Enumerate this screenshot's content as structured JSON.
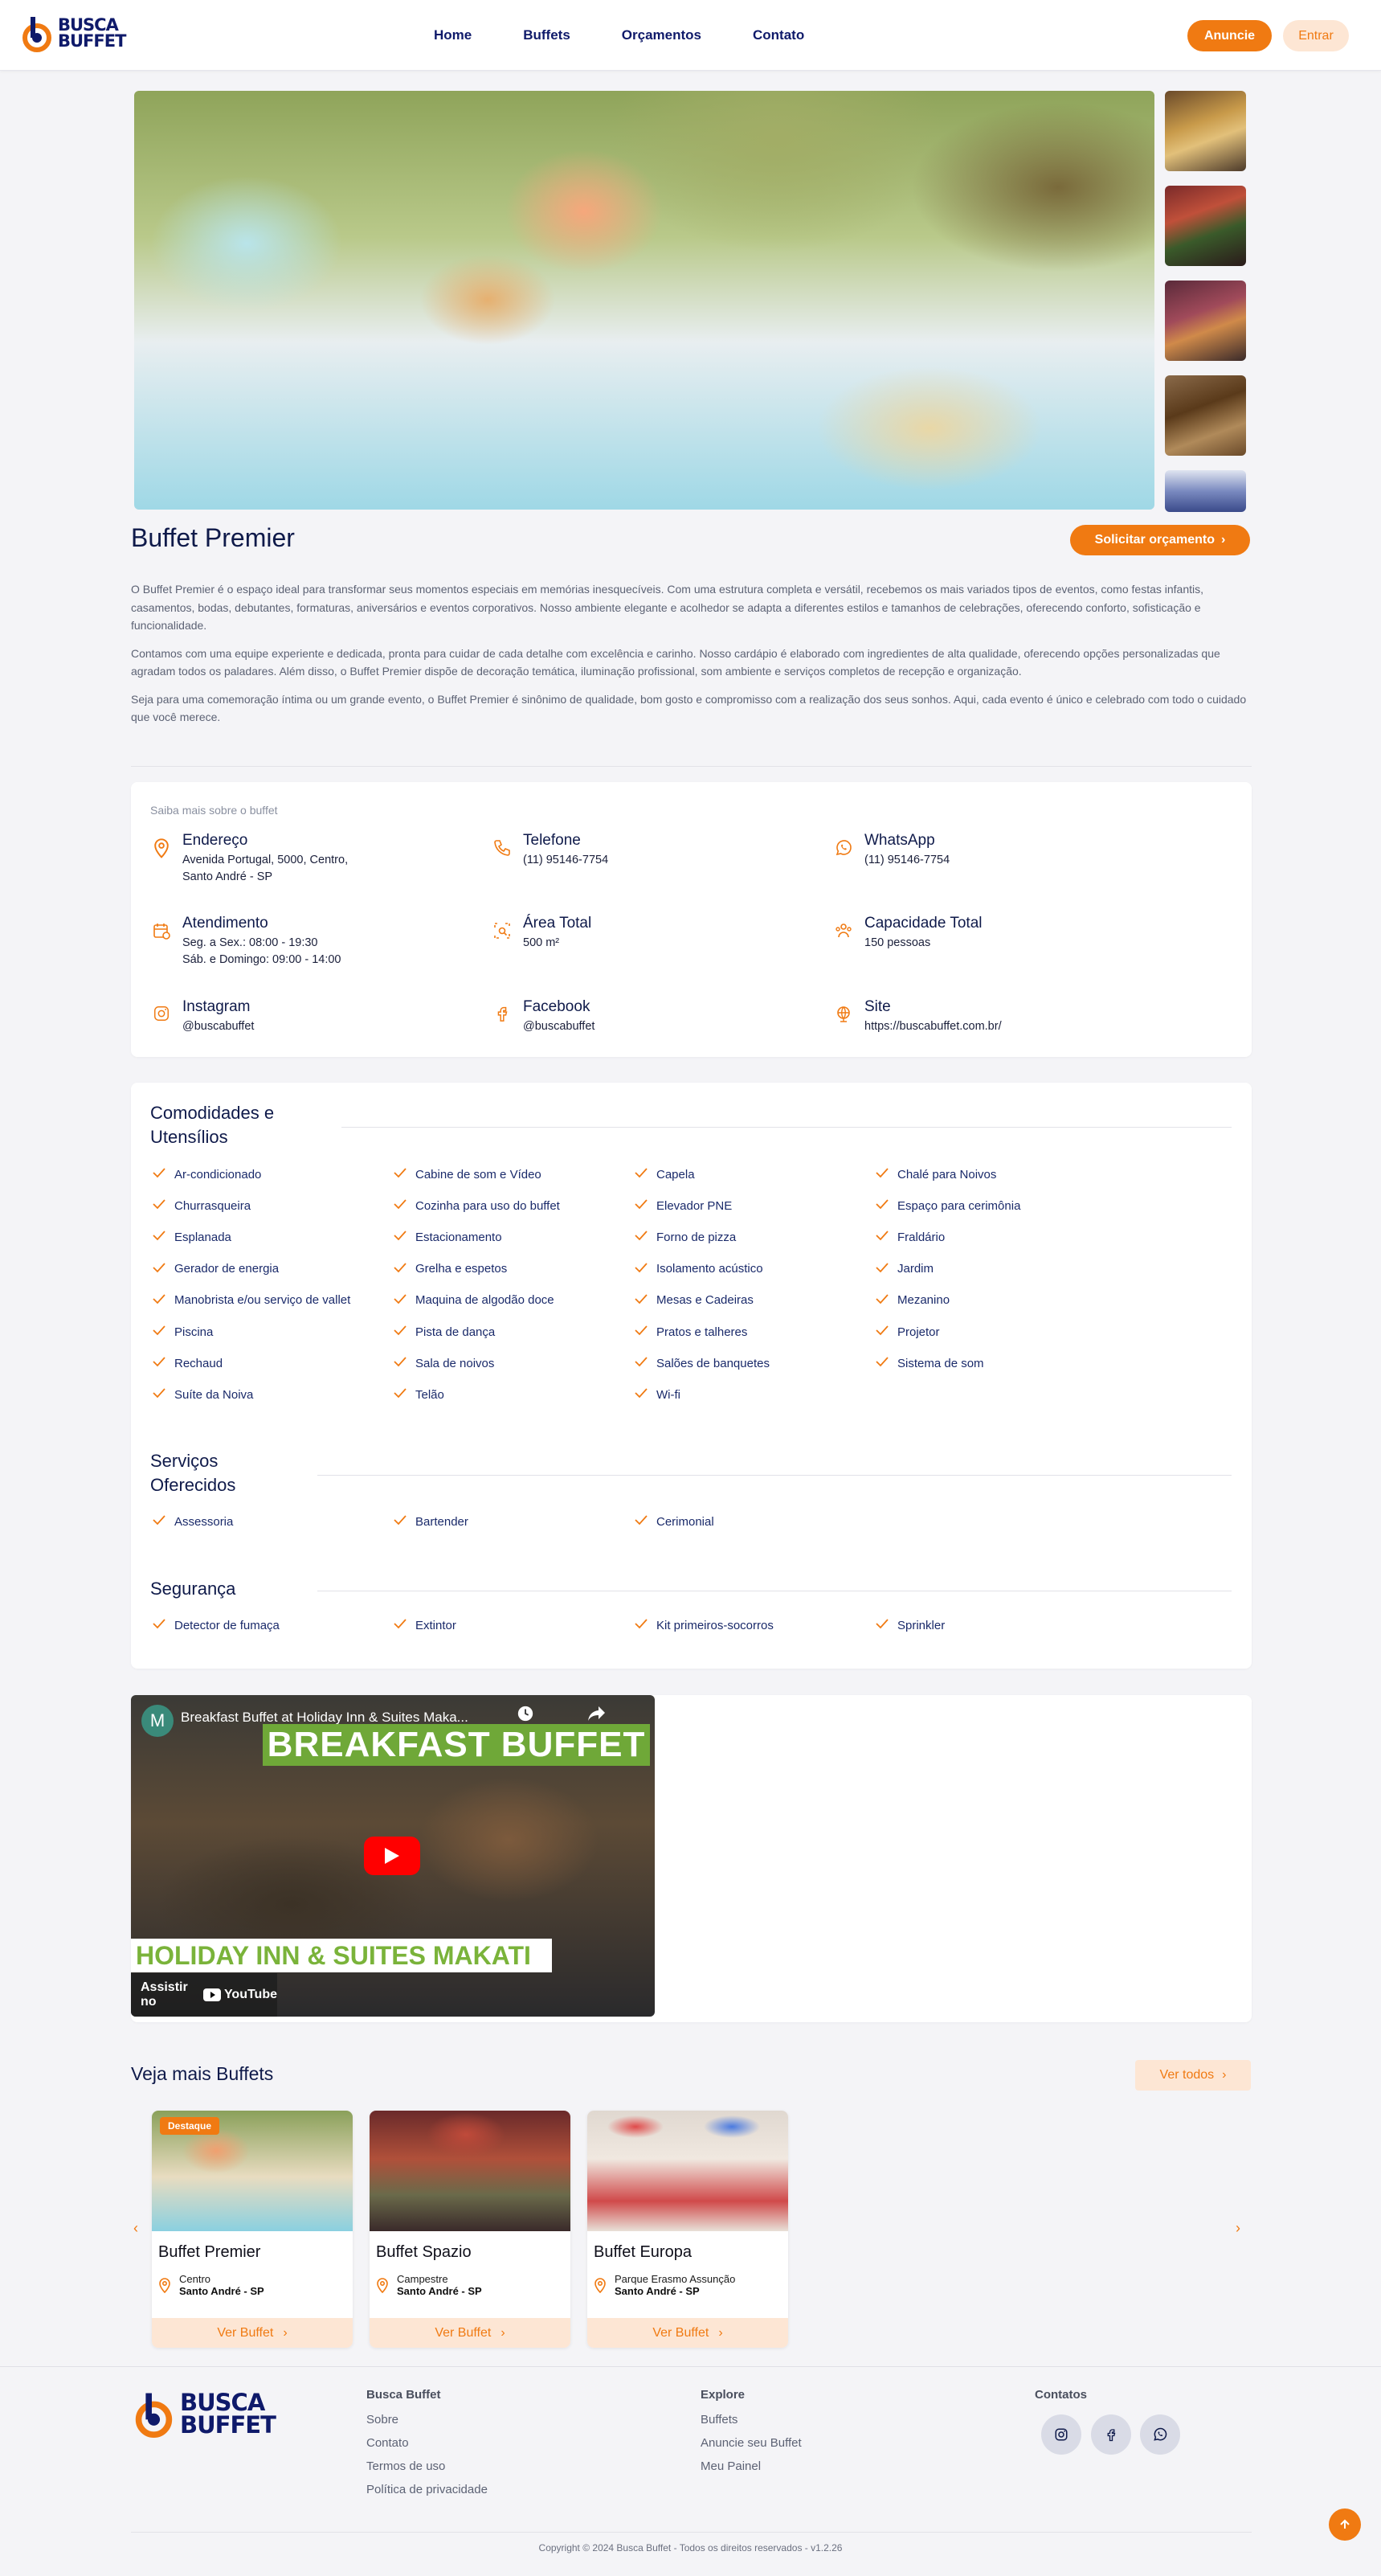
{
  "brand": {
    "line1": "BUSCA",
    "line2": "BUFFET"
  },
  "nav": {
    "links": [
      "Home",
      "Buffets",
      "Orçamentos",
      "Contato"
    ],
    "anuncie": "Anuncie",
    "entrar": "Entrar"
  },
  "buffet": {
    "title": "Buffet Premier",
    "cta": "Solicitar orçamento",
    "description": [
      "O Buffet Premier é o espaço ideal para transformar seus momentos especiais em memórias inesquecíveis. Com uma estrutura completa e versátil, recebemos os mais variados tipos de eventos, como festas infantis, casamentos, bodas, debutantes, formaturas, aniversários e eventos corporativos. Nosso ambiente elegante e acolhedor se adapta a diferentes estilos e tamanhos de celebrações, oferecendo conforto, sofisticação e funcionalidade.",
      "Contamos com uma equipe experiente e dedicada, pronta para cuidar de cada detalhe com excelência e carinho. Nosso cardápio é elaborado com ingredientes de alta qualidade, oferecendo opções personalizadas que agradam todos os paladares. Além disso, o Buffet Premier dispõe de decoração temática, iluminação profissional, som ambiente e serviços completos de recepção e organização.",
      "Seja para uma comemoração íntima ou um grande evento, o Buffet Premier é sinônimo de qualidade, bom gosto e compromisso com a realização dos seus sonhos. Aqui, cada evento é único e celebrado com todo o cuidado que você merece."
    ]
  },
  "info": {
    "heading": "Saiba mais sobre o buffet",
    "items": [
      {
        "label": "Endereço",
        "value": "Avenida Portugal, 5000, Centro,",
        "value2": "Santo André - SP",
        "icon": "map-pin-icon"
      },
      {
        "label": "Telefone",
        "value": "(11) 95146-7754",
        "icon": "phone-icon"
      },
      {
        "label": "WhatsApp",
        "value": "(11) 95146-7754",
        "icon": "whatsapp-icon"
      },
      {
        "label": "Atendimento",
        "value": "Seg. a Sex.: 08:00 - 19:30",
        "value2": "Sáb. e Domingo: 09:00 - 14:00",
        "icon": "calendar-clock-icon"
      },
      {
        "label": "Área Total",
        "value": "500 m²",
        "icon": "area-icon"
      },
      {
        "label": "Capacidade Total",
        "value": "150 pessoas",
        "icon": "people-icon"
      },
      {
        "label": "Instagram",
        "value": "@buscabuffet",
        "icon": "instagram-icon"
      },
      {
        "label": "Facebook",
        "value": "@buscabuffet",
        "icon": "facebook-icon"
      },
      {
        "label": "Site",
        "value": "https://buscabuffet.com.br/",
        "icon": "globe-icon"
      }
    ]
  },
  "amenities": {
    "title_line1": "Comodidades e",
    "title_line2": "Utensílios",
    "items": [
      "Ar-condicionado",
      "Cabine de som e Vídeo",
      "Capela",
      "Chalé para Noivos",
      "Churrasqueira",
      "Cozinha para uso do buffet",
      "Elevador PNE",
      "Espaço para cerimônia",
      "Esplanada",
      "Estacionamento",
      "Forno de pizza",
      "Fraldário",
      "Gerador de energia",
      "Grelha e espetos",
      "Isolamento acústico",
      "Jardim",
      "Manobrista e/ou serviço de vallet",
      "Maquina de algodão doce",
      "Mesas e Cadeiras",
      "Mezanino",
      "Piscina",
      "Pista de dança",
      "Pratos e talheres",
      "Projetor",
      "Rechaud",
      "Sala de noivos",
      "Salões de banquetes",
      "Sistema de som",
      "Suíte da Noiva",
      "Telão",
      "Wi-fi"
    ]
  },
  "services": {
    "title_line1": "Serviços",
    "title_line2": "Oferecidos",
    "items": [
      "Assessoria",
      "Bartender",
      "Cerimonial"
    ]
  },
  "security": {
    "title": "Segurança",
    "items": [
      "Detector de fumaça",
      "Extintor",
      "Kit primeiros-socorros",
      "Sprinkler"
    ]
  },
  "video": {
    "title": "Breakfast Buffet at Holiday Inn & Suites Maka...",
    "banner1": "BREAKFAST BUFFET",
    "banner2": "HOLIDAY INN & SUITES MAKATI",
    "watch": "Assistir no",
    "yt": "YouTube",
    "channel_initial": "M"
  },
  "more": {
    "title": "Veja mais Buffets",
    "ver_todos": "Ver todos",
    "cards": [
      {
        "badge": "Destaque",
        "name": "Buffet Premier",
        "area": "Centro",
        "city": "Santo André - SP",
        "btn": "Ver Buffet"
      },
      {
        "name": "Buffet Spazio",
        "area": "Campestre",
        "city": "Santo André - SP",
        "btn": "Ver Buffet"
      },
      {
        "name": "Buffet Europa",
        "area": "Parque Erasmo Assunção",
        "city": "Santo André - SP",
        "btn": "Ver Buffet"
      }
    ]
  },
  "footer": {
    "col1": {
      "title": "Busca Buffet",
      "links": [
        "Sobre",
        "Contato",
        "Termos de uso",
        "Política de privacidade"
      ]
    },
    "col2": {
      "title": "Explore",
      "links": [
        "Buffets",
        "Anuncie seu Buffet",
        "Meu Painel"
      ]
    },
    "col3": {
      "title": "Contatos"
    },
    "copyright": "Copyright © 2024 Busca Buffet - Todos os direitos reservados - v1.2.26"
  },
  "colors": {
    "accent": "#f07a12",
    "navy": "#0f1a4a",
    "accent_light": "#fde6d4"
  }
}
